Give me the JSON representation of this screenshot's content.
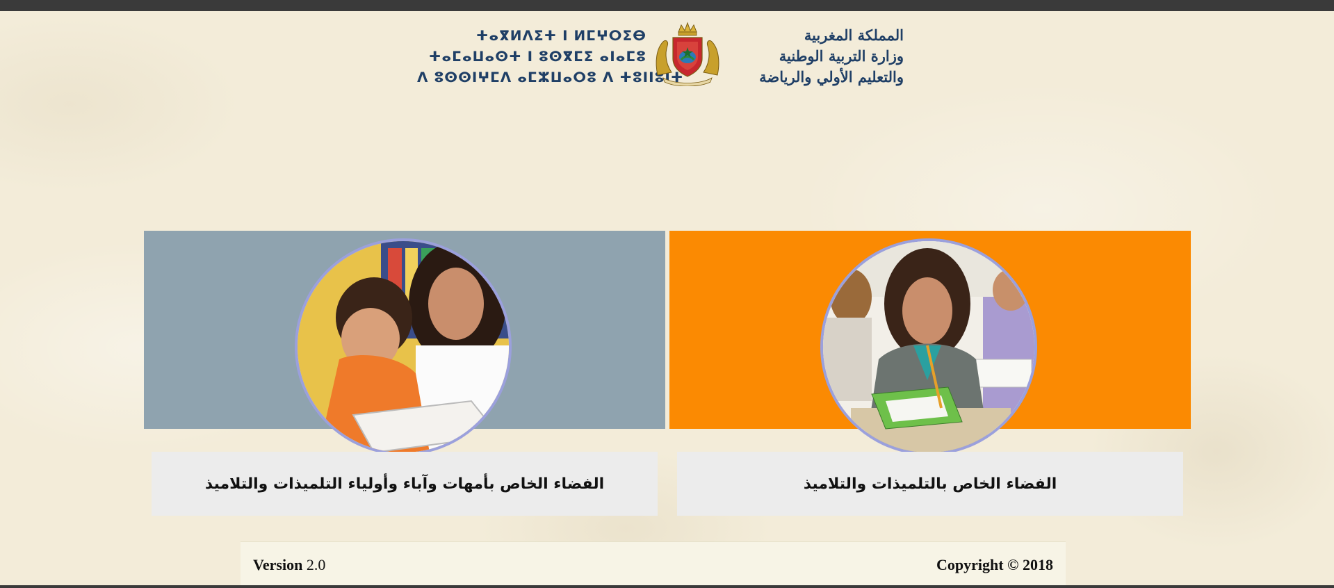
{
  "header": {
    "tifinagh_lines": [
      "ⵜⴰⴳⵍⴷⵉⵜ ⵏ ⵍⵎⵖⵔⵉⴱ",
      "ⵜⴰⵎⴰⵡⴰⵙⵜ ⵏ ⵓⵙⴳⵎⵉ ⴰⵏⴰⵎⵓ",
      "ⴷ ⵓⵙⵙⵏⵖⵎⴷ ⴰⵎⵣⵡⴰⵔⵓ ⴷ ⵜⵓⵏⵏⵓⵏⵜ"
    ],
    "arabic_lines": [
      "المملكة المغربية",
      "وزارة التربية الوطنية",
      "والتعليم الأولي والرياضة"
    ]
  },
  "cards": {
    "parents": {
      "label": "الفضاء الخاص بأمهات وآباء وأولياء التلميذات والتلاميذ",
      "color": "#8fa3af"
    },
    "students": {
      "label": "الفضاء الخاص بالتلميذات والتلاميذ",
      "color": "#fb8a02"
    }
  },
  "footer": {
    "version_label": "Version",
    "version_number": "2.0",
    "copyright": "Copyright © 2018"
  }
}
